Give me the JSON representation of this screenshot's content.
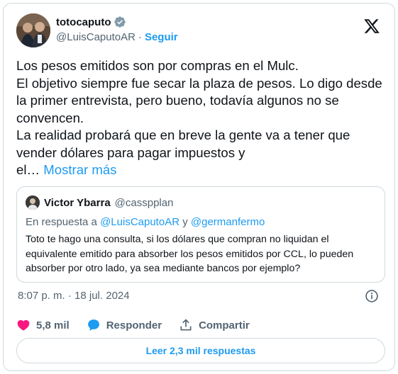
{
  "tweet": {
    "author": {
      "display_name": "totocaputo",
      "handle": "@LuisCaputoAR",
      "separator": "·",
      "follow_label": "Seguir",
      "verified_icon": "verified-badge-icon"
    },
    "body": "Los pesos emitidos son por compras en el Mulc.\nEl objetivo siempre fue secar la plaza de pesos. Lo digo desde la primer entrevista, pero bueno, todavía algunos no se convencen.\nLa realidad probará que en breve la gente va a tener que vender dólares para pagar impuestos y\nel… ",
    "show_more_label": "Mostrar más",
    "quoted": {
      "display_name": "Victor Ybarra",
      "handle": "@casspplan",
      "reply_prefix": "En respuesta a ",
      "reply_mention_1": "@LuisCaputoAR",
      "reply_and": " y ",
      "reply_mention_2": "@germanfermo",
      "text": "Toto te hago una consulta, si los dólares que compran no liquidan el equivalente emitido para absorber los pesos emitidos por CCL, lo pueden absorber por otro lado, ya sea mediante bancos por ejemplo?"
    },
    "timestamp": "8:07 p. m. · 18 jul. 2024",
    "actions": {
      "likes": "5,8 mil",
      "reply_label": "Responder",
      "share_label": "Compartir"
    },
    "read_replies_label": "Leer 2,3 mil respuestas"
  },
  "colors": {
    "accent": "#1d9bf0",
    "like": "#f91880",
    "muted": "#536471",
    "border": "#cfd9de"
  }
}
